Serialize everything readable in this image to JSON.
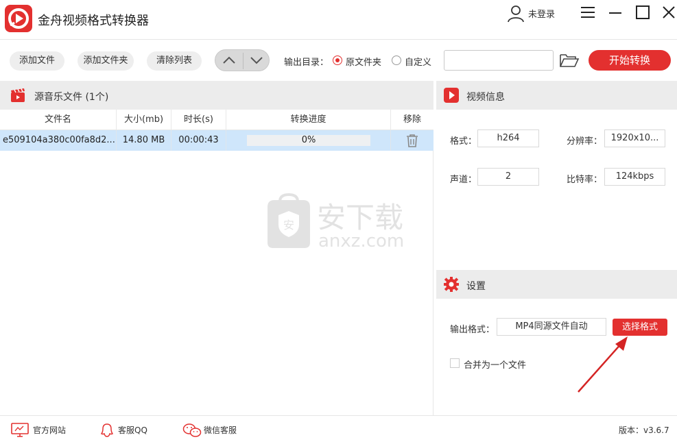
{
  "titlebar": {
    "app_title": "金舟视频格式转换器",
    "user_label": "未登录"
  },
  "toolbar": {
    "add_file": "添加文件",
    "add_folder": "添加文件夹",
    "clear_list": "清除列表",
    "output_dir_label": "输出目录：",
    "radio_original": "原文件夹",
    "radio_custom": "自定义",
    "path_value": "",
    "start_label": "开始转换"
  },
  "file_panel": {
    "title": "源音乐文件 (1个)",
    "columns": [
      "文件名",
      "大小(mb)",
      "时长(s)",
      "转换进度",
      "移除"
    ],
    "rows": [
      {
        "filename": "e509104a380c00fa8d2...",
        "size": "14.80 MB",
        "duration": "00:00:43",
        "progress_text": "0%",
        "progress": 0
      }
    ]
  },
  "video_info": {
    "title": "视频信息",
    "format_label": "格式：",
    "format_value": "h264",
    "resolution_label": "分辨率：",
    "resolution_value": "1920x10...",
    "channel_label": "声道：",
    "channel_value": "2",
    "bitrate_label": "比特率：",
    "bitrate_value": "124kbps"
  },
  "settings": {
    "title": "设置",
    "output_format_label": "输出格式：",
    "output_format_value": "MP4同源文件自动",
    "select_format": "选择格式",
    "merge_label": "合并为一个文件"
  },
  "watermark": {
    "cn": "安下载",
    "en": "anxz.com"
  },
  "footer": {
    "website": "官方网站",
    "qq": "客服QQ",
    "wechat": "微信客服",
    "version": "版本：v3.6.7"
  },
  "colors": {
    "accent": "#e3302f",
    "selected_row": "#cfe6fb",
    "panel_header": "#ececec"
  }
}
